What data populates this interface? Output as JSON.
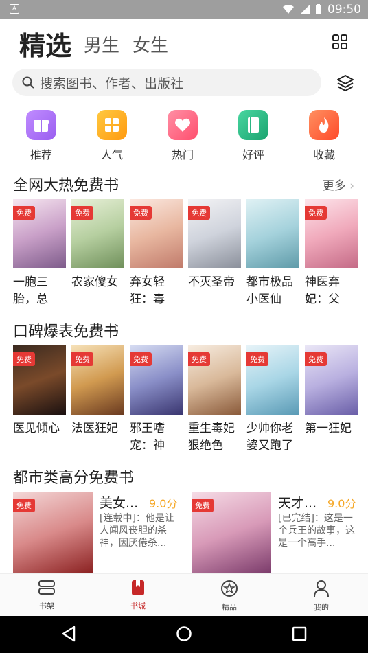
{
  "status": {
    "time": "09:50",
    "left_badge": "A"
  },
  "header": {
    "tabs": [
      "精选",
      "男生",
      "女生"
    ]
  },
  "search": {
    "placeholder": "搜索图书、作者、出版社"
  },
  "categories": [
    {
      "label": "推荐",
      "icon": "gift-icon",
      "color": "#b07ef5"
    },
    {
      "label": "人气",
      "icon": "grid-icon",
      "color": "#ffb020"
    },
    {
      "label": "热门",
      "icon": "heart-icon",
      "color": "#ff6f8a"
    },
    {
      "label": "好评",
      "icon": "book-icon",
      "color": "#2fbf8a"
    },
    {
      "label": "收藏",
      "icon": "flame-icon",
      "color": "#ff6a3d"
    }
  ],
  "section1": {
    "title": "全网大热免费书",
    "more": "更多",
    "books": [
      {
        "badge": "免费",
        "title": "一胞三胎，总裁..."
      },
      {
        "badge": "免费",
        "title": "农家傻女"
      },
      {
        "badge": "免费",
        "title": "弃女轻狂：毒妃..."
      },
      {
        "badge": "免费",
        "title": "不灭圣帝"
      },
      {
        "badge": "",
        "title": "都市极品小医仙"
      },
      {
        "badge": "免费",
        "title": "神医弃妃：父王..."
      }
    ]
  },
  "section2": {
    "title": "口碑爆表免费书",
    "books": [
      {
        "badge": "免费",
        "title": "医见倾心"
      },
      {
        "badge": "免费",
        "title": "法医狂妃"
      },
      {
        "badge": "免费",
        "title": "邪王嗜宠：神医..."
      },
      {
        "badge": "免费",
        "title": "重生毒妃狠绝色"
      },
      {
        "badge": "免费",
        "title": "少帅你老婆又跑了"
      },
      {
        "badge": "免费",
        "title": "第一狂妃"
      }
    ]
  },
  "section3": {
    "title": "都市类高分免费书",
    "books": [
      {
        "badge": "免费",
        "title": "美女...",
        "score": "9.0分",
        "desc": "[连载中]：他是让人闻风丧胆的杀神，因厌倦杀..."
      },
      {
        "badge": "免费",
        "title": "天才...",
        "score": "9.0分",
        "desc": "[已完结]：这是一个兵王的故事，这是一个高手..."
      }
    ]
  },
  "bottom_nav": [
    {
      "label": "书架",
      "icon": "bookshelf-icon"
    },
    {
      "label": "书城",
      "icon": "bookstore-icon",
      "active": true
    },
    {
      "label": "精品",
      "icon": "premium-icon"
    },
    {
      "label": "我的",
      "icon": "profile-icon"
    }
  ],
  "colors": {
    "accent": "#c62828",
    "score": "#f5a623"
  }
}
